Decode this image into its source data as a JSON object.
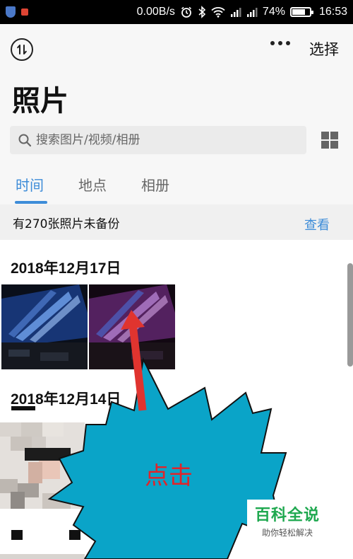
{
  "status_bar": {
    "speed": "0.00B/s",
    "battery": "74%",
    "battery_level": 0.74,
    "time": "16:53"
  },
  "header": {
    "select_label": "选择",
    "title": "照片"
  },
  "search": {
    "placeholder": "搜索图片/视频/相册"
  },
  "tabs": [
    {
      "label": "时间",
      "active": true
    },
    {
      "label": "地点",
      "active": false
    },
    {
      "label": "相册",
      "active": false
    }
  ],
  "backup": {
    "text": "有270张照片未备份",
    "link": "查看"
  },
  "groups": [
    {
      "date": "2018年12月17日"
    },
    {
      "date": "2018年12月14日"
    }
  ],
  "annotation": {
    "label": "点击"
  },
  "watermark": {
    "title": "百科全说",
    "subtitle": "助你轻松解决"
  },
  "colors": {
    "accent": "#3d8cd8",
    "callout_fill": "#0aa4c8",
    "callout_text": "#e0242a",
    "arrow": "#e0342f",
    "watermark": "#1ea84f"
  }
}
